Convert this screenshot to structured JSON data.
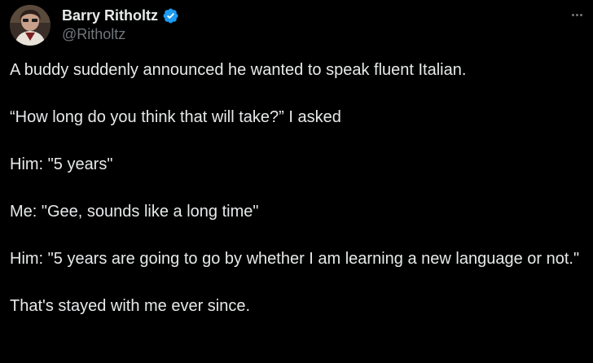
{
  "author": {
    "name": "Barry Ritholtz",
    "handle": "@Ritholtz",
    "verified": true
  },
  "icons": {
    "avatar": "profile-photo",
    "verified": "verified-badge-icon",
    "more": "more-horizontal-icon"
  },
  "colors": {
    "background": "#000000",
    "text": "#e7e9ea",
    "secondary_text": "#71767b",
    "verified_blue": "#1d9bf0"
  },
  "tweet": {
    "paragraphs": [
      "A buddy suddenly announced he wanted to speak fluent Italian.",
      "“How long do you think that will take?” I asked",
      "Him: \"5 years\"",
      "Me: \"Gee, sounds like a long time\"",
      "Him: \"5 years are going to go by whether I am learning a new language or not.\"",
      "That's stayed with me ever since."
    ]
  }
}
